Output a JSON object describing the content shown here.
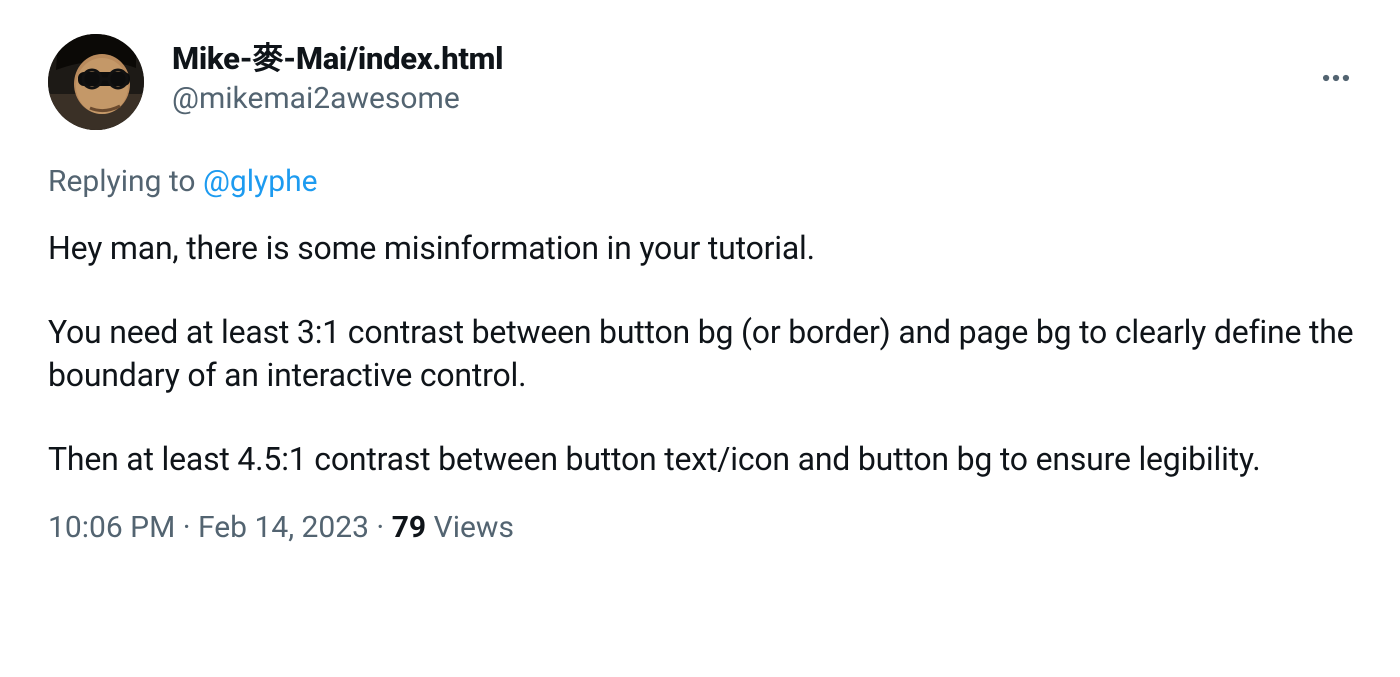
{
  "author": {
    "display_name": "Mike-麥-Mai/index.html",
    "handle": "@mikemai2awesome"
  },
  "reply": {
    "prefix": "Replying to ",
    "mention": "@glyphe"
  },
  "body": "Hey man, there is some misinformation in your tutorial.\n\nYou need at least 3:1 contrast between button bg (or border) and page bg to clearly define the boundary of an interactive control.\n\nThen at least 4.5:1 contrast between button text/icon and button bg to ensure legibility.",
  "meta": {
    "time": "10:06 PM",
    "sep1": " · ",
    "date": "Feb 14, 2023",
    "sep2": " · ",
    "views_count": "79",
    "views_label": " Views"
  }
}
